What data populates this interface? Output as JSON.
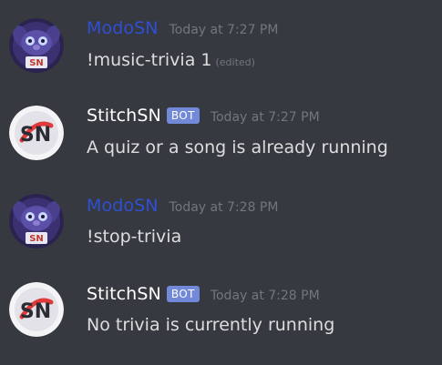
{
  "messages": [
    {
      "username": "ModoSN",
      "is_bot": false,
      "timestamp": "Today at 7:27 PM",
      "content": "!music-trivia 1",
      "edited": "(edited)"
    },
    {
      "username": "StitchSN",
      "is_bot": true,
      "bot_label": "BOT",
      "timestamp": "Today at 7:27 PM",
      "content": "A quiz or a song is already running"
    },
    {
      "username": "ModoSN",
      "is_bot": false,
      "timestamp": "Today at 7:28 PM",
      "content": "!stop-trivia"
    },
    {
      "username": "StitchSN",
      "is_bot": true,
      "bot_label": "BOT",
      "timestamp": "Today at 7:28 PM",
      "content": "No trivia is currently running"
    }
  ],
  "avatars": {
    "modo": {
      "icon": "stitch-avatar-icon",
      "text": "SN"
    },
    "stitch": {
      "icon": "sn-logo-avatar-icon",
      "text": "SN"
    }
  },
  "colors": {
    "background": "#36393f",
    "modo_username": "#2f4fd4",
    "bot_username": "#ffffff",
    "bot_tag": "#7289da",
    "timestamp": "#72767d",
    "message_text": "#dcddde"
  }
}
